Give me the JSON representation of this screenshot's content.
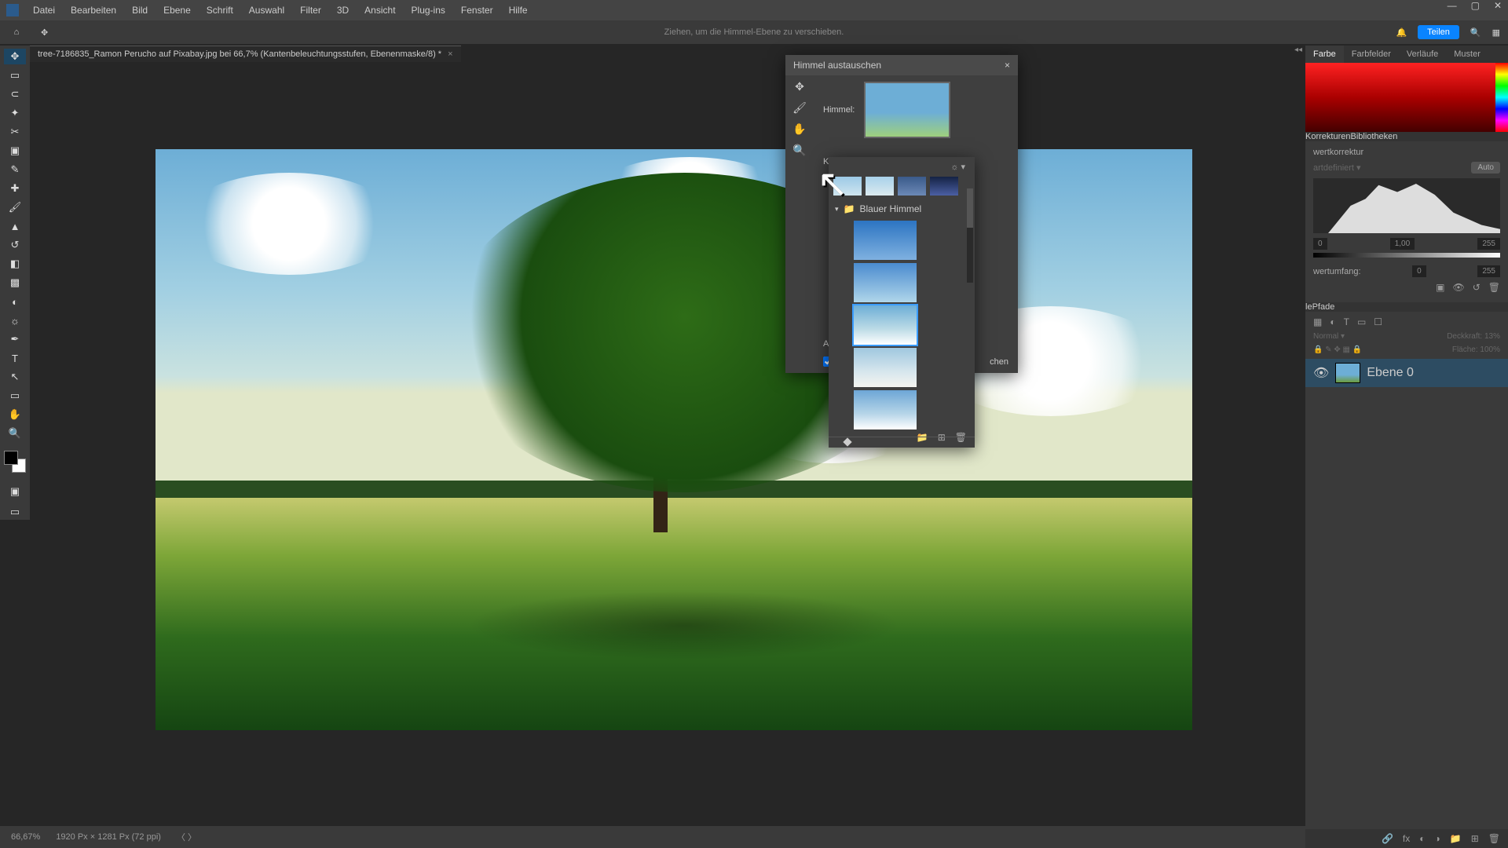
{
  "menubar": {
    "items": [
      "Datei",
      "Bearbeiten",
      "Bild",
      "Ebene",
      "Schrift",
      "Auswahl",
      "Filter",
      "3D",
      "Ansicht",
      "Plug-ins",
      "Fenster",
      "Hilfe"
    ]
  },
  "options": {
    "hint": "Ziehen, um die Himmel-Ebene zu verschieben.",
    "share": "Teilen"
  },
  "tab": {
    "name": "tree-7186835_Ramon Perucho auf Pixabay.jpg bei 66,7% (Kantenbeleuchtungsstufen, Ebenenmaske/8) *",
    "close": "×"
  },
  "status": {
    "zoom": "66,67%",
    "info": "1920 Px × 1281 Px (72 ppi)",
    "nav": "〈  〉"
  },
  "right_tabs": {
    "color": [
      "Farbe",
      "Farbfelder",
      "Verläufe",
      "Muster"
    ],
    "adj": [
      "Korrekturen",
      "Bibliotheken"
    ],
    "adj_name": "wertkorrektur",
    "auto": "Auto",
    "range_label": "wertumfang:",
    "val0": "0",
    "val255": "255",
    "layers": [
      "le",
      "Pfade"
    ],
    "deckkraft": "Deckkraft:",
    "deck_val": "13%",
    "flache": "Fläche:",
    "flache_val": "100%"
  },
  "layer": {
    "name": "Ebene 0"
  },
  "modal": {
    "title": "Himmel austauschen",
    "close": "×",
    "label_himmel": "Himmel:",
    "btn": "chen",
    "letter1": "K",
    "letter2": "A"
  },
  "picker": {
    "folder": "Blauer Himmel",
    "gear": "☼ ▾"
  },
  "icons": {
    "home": "⌂",
    "move": "✥",
    "search": "🔍",
    "bell": "🔔",
    "gear": "⚙",
    "eye": "👁",
    "lock": "🔒",
    "trash": "🗑",
    "folder": "📁",
    "plus": "⊞",
    "link": "🔗",
    "fx": "fx"
  }
}
